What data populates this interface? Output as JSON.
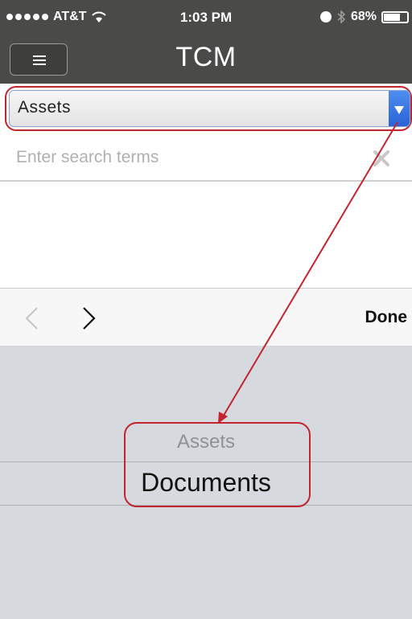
{
  "status_bar": {
    "carrier": "AT&T",
    "time": "1:03 PM",
    "battery": "68%",
    "icons": [
      "signal-dots-icon",
      "wifi-icon",
      "alarm-icon",
      "bluetooth-icon",
      "battery-icon"
    ]
  },
  "nav": {
    "title": "TCM",
    "menu_icon": "hamburger-menu-icon"
  },
  "select": {
    "value": "Assets",
    "arrow_icon": "dropdown-triangle-icon"
  },
  "search": {
    "placeholder": "Enter search terms",
    "value": "",
    "clear_icon": "clear-x-icon"
  },
  "toolbar": {
    "prev_icon": "chevron-left-icon",
    "next_icon": "chevron-right-icon",
    "done_label": "Done"
  },
  "picker": {
    "options": [
      "Assets",
      "Documents"
    ],
    "selected": "Documents"
  },
  "colors": {
    "bar_dark": "#4a4a48",
    "annotation_red": "#c3242f",
    "select_arrow_blue": "#2a63d6",
    "picker_bg": "#d6dade"
  }
}
